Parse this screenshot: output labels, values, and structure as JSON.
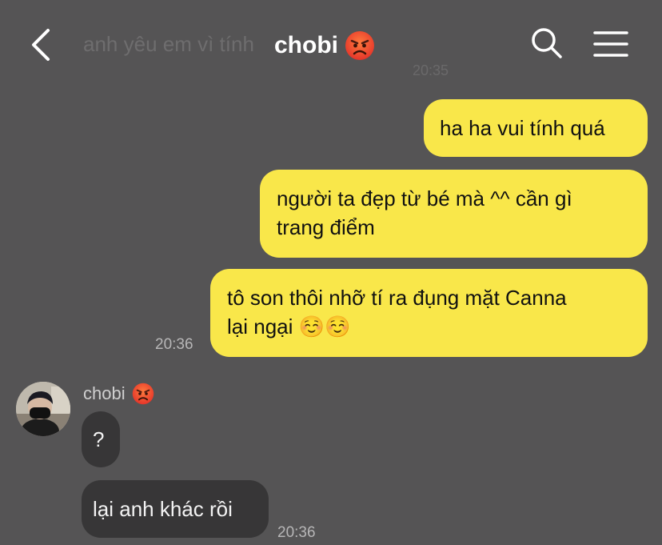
{
  "header": {
    "title": "chobi",
    "faded_message": "anh yêu em vì tính",
    "faded_time": "20:35"
  },
  "messages": {
    "out1": "ha ha vui tính quá",
    "out2_line1": "người ta đẹp từ bé mà ^^ cần gì",
    "out2_line2": "trang điểm",
    "out3_line1": "tô son thôi nhỡ tí ra đụng mặt Canna",
    "out3_line2": "lại ngại ☺️☺️",
    "out_time": "20:36",
    "sender_name": "chobi",
    "in1": "?",
    "in2": "lại anh khác rồi",
    "in_time": "20:36"
  },
  "colors": {
    "background": "#555455",
    "outgoing_bubble": "#f9e74a",
    "incoming_bubble": "#373637"
  },
  "icons": {
    "back": "chevron-left-icon",
    "search": "search-icon",
    "menu": "hamburger-menu-icon",
    "title_emoji": "angry-face-icon"
  }
}
